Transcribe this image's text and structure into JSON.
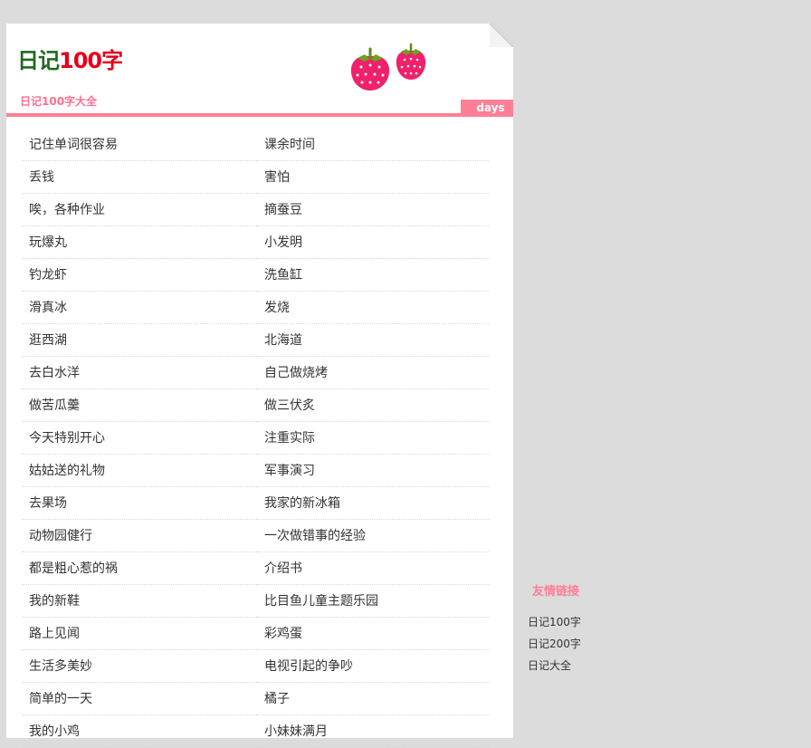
{
  "header": {
    "logo_part1": "日记",
    "logo_part2": "100字",
    "subtitle": "日记100字大全",
    "tab_label": "days"
  },
  "entries": [
    "记住单词很容易",
    "课余时间",
    "丢钱",
    "害怕",
    "唉，各种作业",
    "摘蚕豆",
    "玩爆丸",
    "小发明",
    "钓龙虾",
    "洗鱼缸",
    "滑真冰",
    "发烧",
    "逛西湖",
    "北海道",
    "去白水洋",
    "自己做烧烤",
    "做苦瓜羹",
    "做三伏炙",
    "今天特别开心",
    "注重实际",
    "姑姑送的礼物",
    "军事演习",
    "去果场",
    "我家的新冰箱",
    "动物园健行",
    "一次做错事的经验",
    "都是粗心惹的祸",
    "介绍书",
    "我的新鞋",
    "比目鱼儿童主题乐园",
    "路上见闻",
    "彩鸡蛋",
    "生活多美妙",
    "电视引起的争吵",
    "简单的一天",
    "橘子",
    "我的小鸡",
    "小妹妹满月"
  ],
  "sidebar": {
    "title": "友情链接",
    "links": [
      "日记100字",
      "日记200字",
      "日记大全"
    ]
  },
  "colors": {
    "background": "#dcdcdc",
    "accent_pink": "#ff7f97",
    "logo_green": "#1f6a1f",
    "logo_red": "#e4001b",
    "strawberry": "#f0206a"
  },
  "icons": [
    "strawberry-icon",
    "strawberry-icon"
  ]
}
